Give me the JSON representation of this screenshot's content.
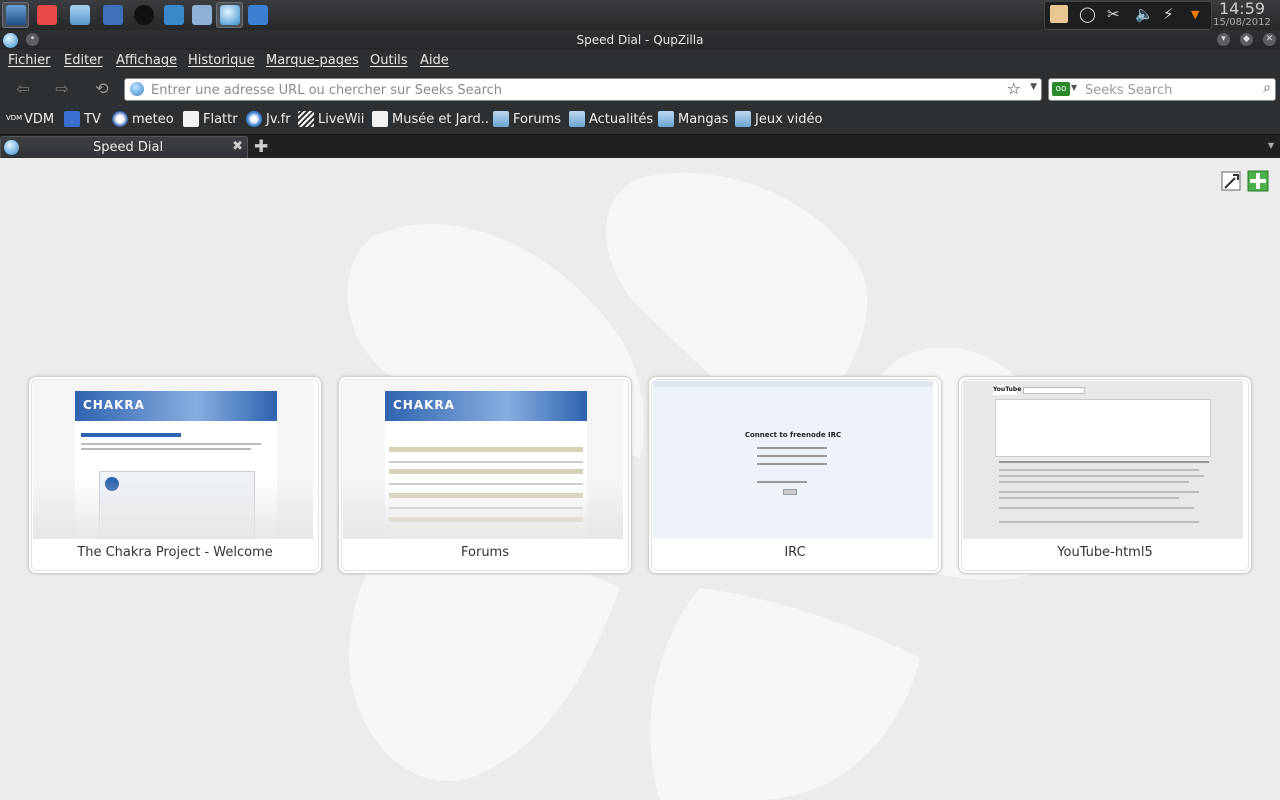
{
  "taskbar": {
    "clock_time": "14:59",
    "clock_date": "15/08/2012"
  },
  "window": {
    "title": "Speed Dial - QupZilla"
  },
  "menu": {
    "items": [
      "Fichier",
      "Editer",
      "Affichage",
      "Historique",
      "Marque-pages",
      "Outils",
      "Aide"
    ]
  },
  "navbar": {
    "url_placeholder": "Entrer une adresse URL ou chercher sur Seeks Search",
    "search_placeholder": "Seeks Search"
  },
  "bookmarks": {
    "items": [
      "VDM",
      "TV",
      "meteo",
      "Flattr",
      "Jv.fr",
      "LiveWii",
      "Musée et Jard..",
      "Forums",
      "Actualités",
      "Mangas",
      "Jeux vidéo"
    ],
    "vdm_icon_text": "VDM"
  },
  "tabs": {
    "active_label": "Speed Dial"
  },
  "speed_dial": {
    "dials": [
      {
        "title": "The Chakra Project - Welcome",
        "logo": "CHAKRA"
      },
      {
        "title": "Forums",
        "logo": "CHAKRA"
      },
      {
        "title": "IRC",
        "heading": "Connect to freenode IRC"
      },
      {
        "title": "YouTube-html5",
        "logo": "YouTube"
      }
    ]
  },
  "colors": {
    "panel_bg": "#2d3033",
    "content_bg": "#ececec",
    "chakra_blue": "#2f63b0"
  }
}
